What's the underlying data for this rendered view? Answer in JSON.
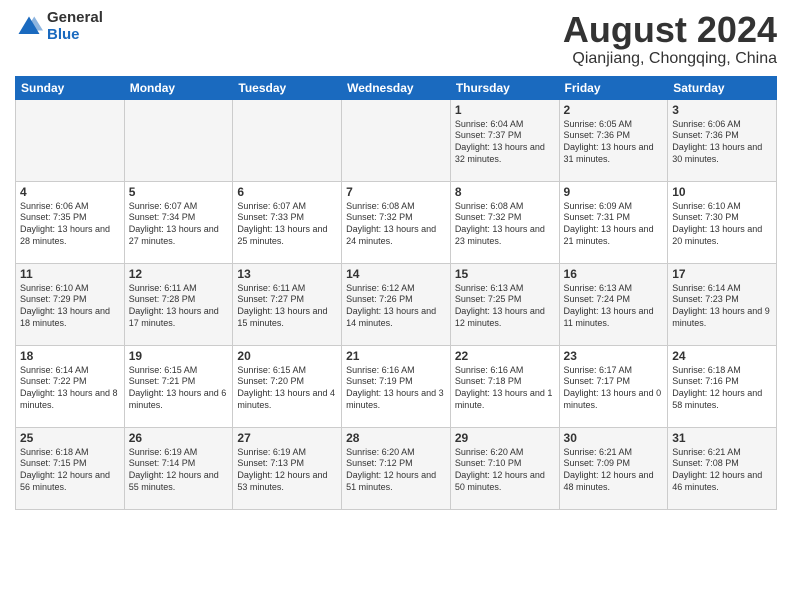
{
  "header": {
    "logo_general": "General",
    "logo_blue": "Blue",
    "month_title": "August 2024",
    "location": "Qianjiang, Chongqing, China"
  },
  "weekdays": [
    "Sunday",
    "Monday",
    "Tuesday",
    "Wednesday",
    "Thursday",
    "Friday",
    "Saturday"
  ],
  "weeks": [
    [
      {
        "day": "",
        "info": ""
      },
      {
        "day": "",
        "info": ""
      },
      {
        "day": "",
        "info": ""
      },
      {
        "day": "",
        "info": ""
      },
      {
        "day": "1",
        "info": "Sunrise: 6:04 AM\nSunset: 7:37 PM\nDaylight: 13 hours and 32 minutes."
      },
      {
        "day": "2",
        "info": "Sunrise: 6:05 AM\nSunset: 7:36 PM\nDaylight: 13 hours and 31 minutes."
      },
      {
        "day": "3",
        "info": "Sunrise: 6:06 AM\nSunset: 7:36 PM\nDaylight: 13 hours and 30 minutes."
      }
    ],
    [
      {
        "day": "4",
        "info": "Sunrise: 6:06 AM\nSunset: 7:35 PM\nDaylight: 13 hours and 28 minutes."
      },
      {
        "day": "5",
        "info": "Sunrise: 6:07 AM\nSunset: 7:34 PM\nDaylight: 13 hours and 27 minutes."
      },
      {
        "day": "6",
        "info": "Sunrise: 6:07 AM\nSunset: 7:33 PM\nDaylight: 13 hours and 25 minutes."
      },
      {
        "day": "7",
        "info": "Sunrise: 6:08 AM\nSunset: 7:32 PM\nDaylight: 13 hours and 24 minutes."
      },
      {
        "day": "8",
        "info": "Sunrise: 6:08 AM\nSunset: 7:32 PM\nDaylight: 13 hours and 23 minutes."
      },
      {
        "day": "9",
        "info": "Sunrise: 6:09 AM\nSunset: 7:31 PM\nDaylight: 13 hours and 21 minutes."
      },
      {
        "day": "10",
        "info": "Sunrise: 6:10 AM\nSunset: 7:30 PM\nDaylight: 13 hours and 20 minutes."
      }
    ],
    [
      {
        "day": "11",
        "info": "Sunrise: 6:10 AM\nSunset: 7:29 PM\nDaylight: 13 hours and 18 minutes."
      },
      {
        "day": "12",
        "info": "Sunrise: 6:11 AM\nSunset: 7:28 PM\nDaylight: 13 hours and 17 minutes."
      },
      {
        "day": "13",
        "info": "Sunrise: 6:11 AM\nSunset: 7:27 PM\nDaylight: 13 hours and 15 minutes."
      },
      {
        "day": "14",
        "info": "Sunrise: 6:12 AM\nSunset: 7:26 PM\nDaylight: 13 hours and 14 minutes."
      },
      {
        "day": "15",
        "info": "Sunrise: 6:13 AM\nSunset: 7:25 PM\nDaylight: 13 hours and 12 minutes."
      },
      {
        "day": "16",
        "info": "Sunrise: 6:13 AM\nSunset: 7:24 PM\nDaylight: 13 hours and 11 minutes."
      },
      {
        "day": "17",
        "info": "Sunrise: 6:14 AM\nSunset: 7:23 PM\nDaylight: 13 hours and 9 minutes."
      }
    ],
    [
      {
        "day": "18",
        "info": "Sunrise: 6:14 AM\nSunset: 7:22 PM\nDaylight: 13 hours and 8 minutes."
      },
      {
        "day": "19",
        "info": "Sunrise: 6:15 AM\nSunset: 7:21 PM\nDaylight: 13 hours and 6 minutes."
      },
      {
        "day": "20",
        "info": "Sunrise: 6:15 AM\nSunset: 7:20 PM\nDaylight: 13 hours and 4 minutes."
      },
      {
        "day": "21",
        "info": "Sunrise: 6:16 AM\nSunset: 7:19 PM\nDaylight: 13 hours and 3 minutes."
      },
      {
        "day": "22",
        "info": "Sunrise: 6:16 AM\nSunset: 7:18 PM\nDaylight: 13 hours and 1 minute."
      },
      {
        "day": "23",
        "info": "Sunrise: 6:17 AM\nSunset: 7:17 PM\nDaylight: 13 hours and 0 minutes."
      },
      {
        "day": "24",
        "info": "Sunrise: 6:18 AM\nSunset: 7:16 PM\nDaylight: 12 hours and 58 minutes."
      }
    ],
    [
      {
        "day": "25",
        "info": "Sunrise: 6:18 AM\nSunset: 7:15 PM\nDaylight: 12 hours and 56 minutes."
      },
      {
        "day": "26",
        "info": "Sunrise: 6:19 AM\nSunset: 7:14 PM\nDaylight: 12 hours and 55 minutes."
      },
      {
        "day": "27",
        "info": "Sunrise: 6:19 AM\nSunset: 7:13 PM\nDaylight: 12 hours and 53 minutes."
      },
      {
        "day": "28",
        "info": "Sunrise: 6:20 AM\nSunset: 7:12 PM\nDaylight: 12 hours and 51 minutes."
      },
      {
        "day": "29",
        "info": "Sunrise: 6:20 AM\nSunset: 7:10 PM\nDaylight: 12 hours and 50 minutes."
      },
      {
        "day": "30",
        "info": "Sunrise: 6:21 AM\nSunset: 7:09 PM\nDaylight: 12 hours and 48 minutes."
      },
      {
        "day": "31",
        "info": "Sunrise: 6:21 AM\nSunset: 7:08 PM\nDaylight: 12 hours and 46 minutes."
      }
    ]
  ]
}
